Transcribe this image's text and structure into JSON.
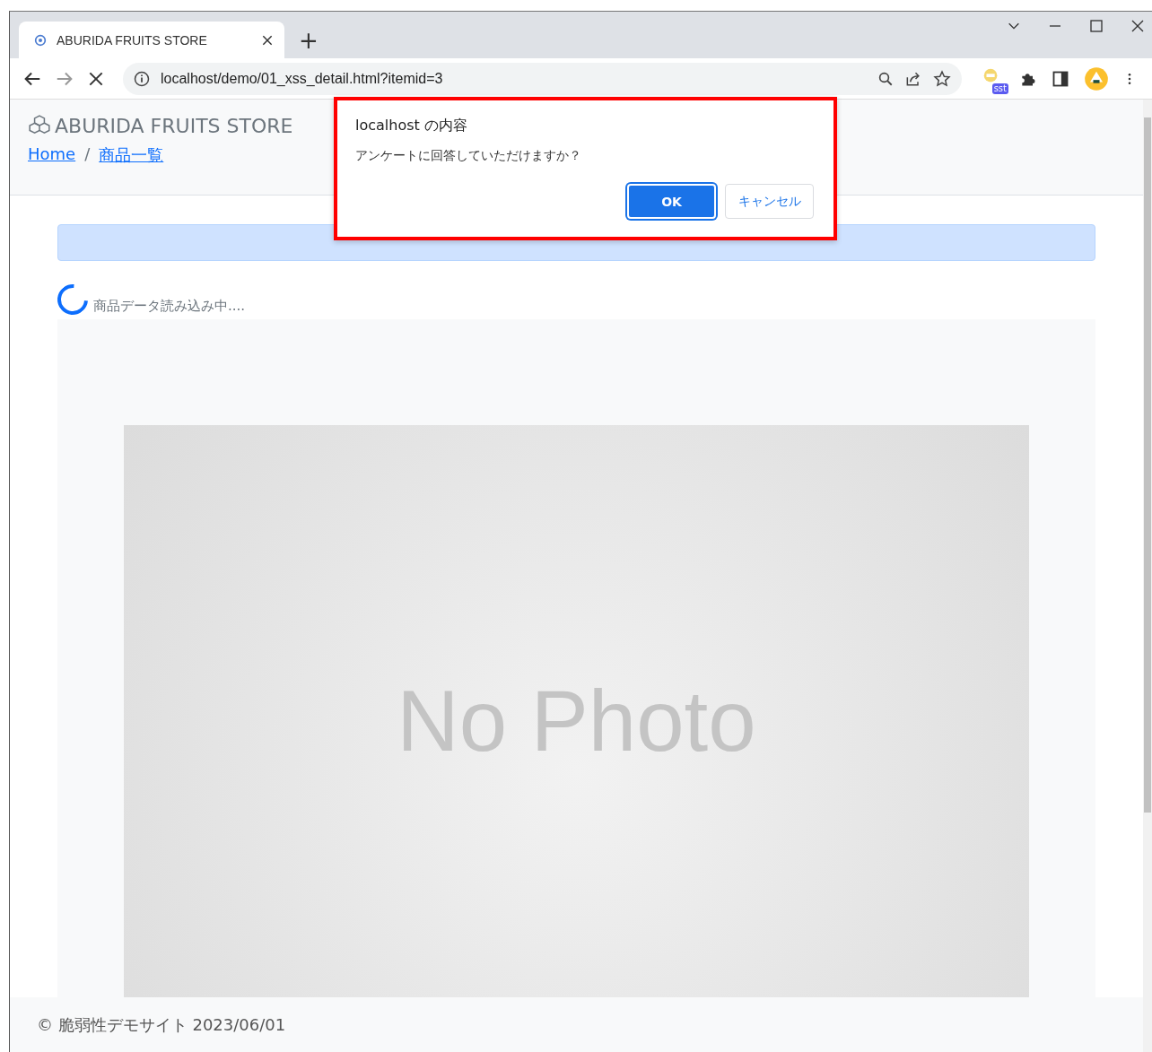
{
  "browser": {
    "tab": {
      "title": "ABURIDA FRUITS STORE",
      "selected": true
    },
    "new_tab": "+",
    "url": "localhost/demo/01_xss_detail.html?itemid=3",
    "extension_badge": "sst"
  },
  "page": {
    "brand": "ABURIDA FRUITS STORE",
    "breadcrumb": [
      {
        "label": "Home"
      },
      {
        "label": "商品一覧"
      }
    ],
    "breadcrumb_separator": "/",
    "loading_text": "商品データ読み込み中....",
    "photo_placeholder": "No Photo",
    "footer": "© 脆弱性デモサイト 2023/06/01"
  },
  "dialog": {
    "title": "localhost の内容",
    "message": "アンケートに回答していただけますか？",
    "buttons": [
      {
        "label": "OK",
        "selected": true
      },
      {
        "label": "キャンセル",
        "selected": false
      }
    ]
  }
}
